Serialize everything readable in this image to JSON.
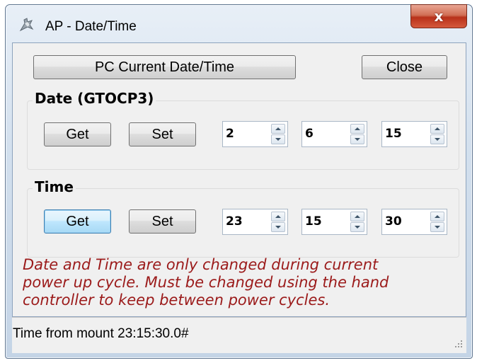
{
  "window": {
    "title": "AP - Date/Time",
    "close_glyph": "x",
    "app_icon": "astro-physics-icon"
  },
  "toolbar": {
    "pc_time_label": "PC Current Date/Time",
    "close_label": "Close"
  },
  "date_group": {
    "label": "Date (GTOCP3)",
    "get_label": "Get",
    "set_label": "Set",
    "fields": [
      {
        "value": "2"
      },
      {
        "value": "6"
      },
      {
        "value": "15"
      }
    ]
  },
  "time_group": {
    "label": "Time",
    "get_label": "Get",
    "set_label": "Set",
    "fields": [
      {
        "value": "23"
      },
      {
        "value": "15"
      },
      {
        "value": "30"
      }
    ]
  },
  "note": {
    "lines": [
      "Date and Time are only changed during current",
      "power up cycle.  Must be changed using the hand",
      "controller to keep between power cycles."
    ],
    "color": "#9b1a1a"
  },
  "status": {
    "text": "Time from mount 23:15:30.0#"
  }
}
